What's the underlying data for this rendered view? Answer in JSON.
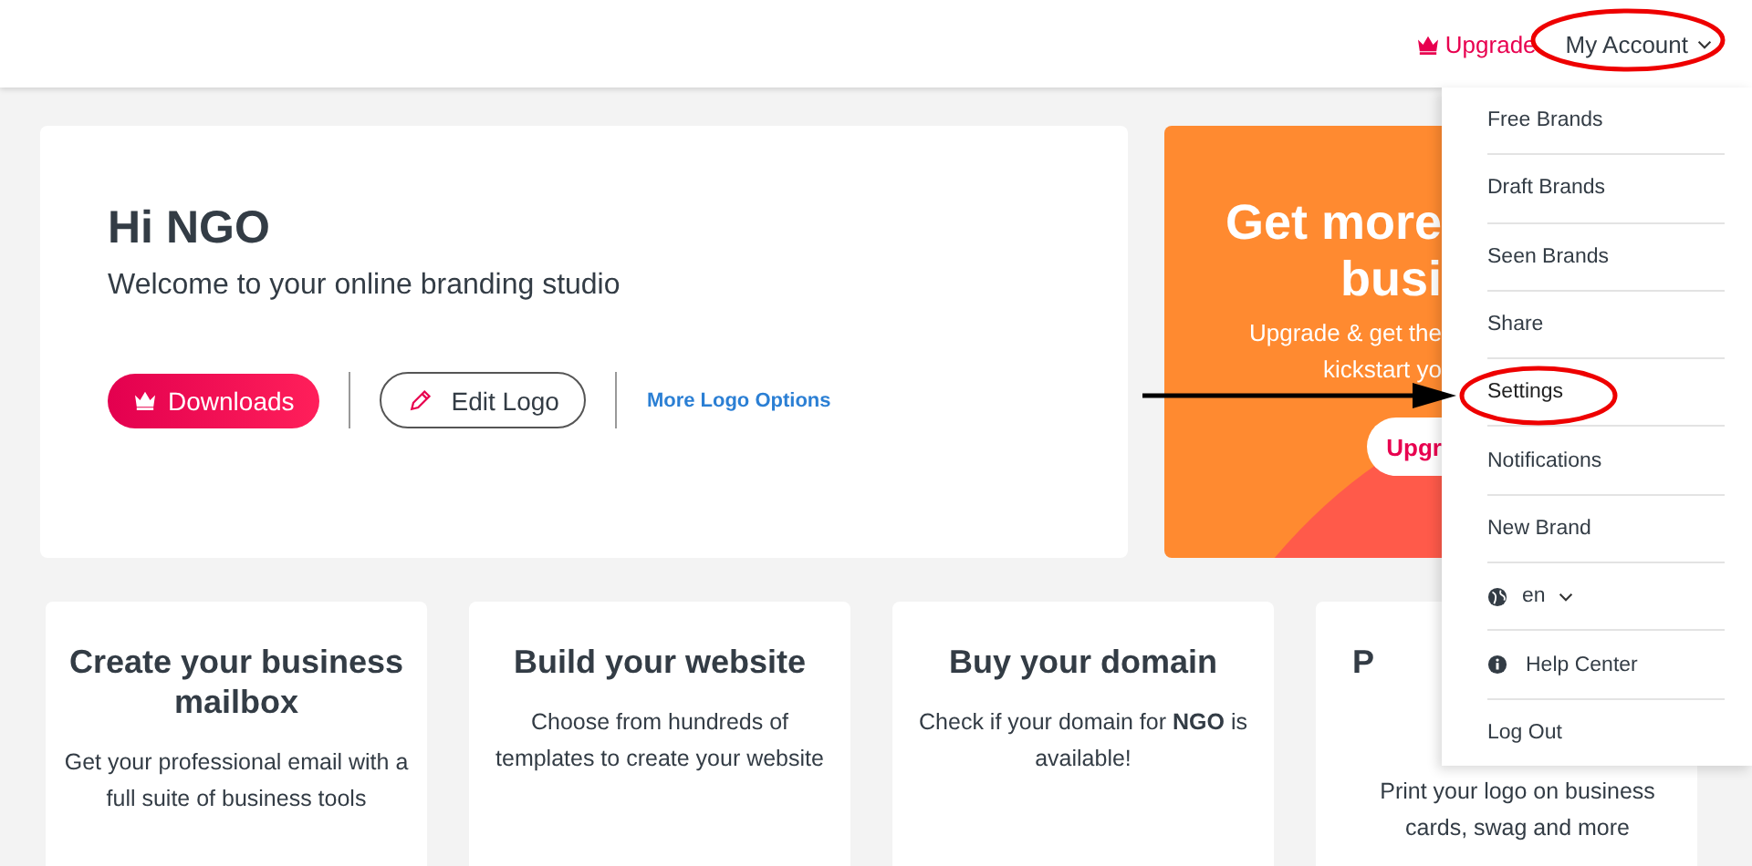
{
  "header": {
    "upgrade": "Upgrade",
    "account": "My Account"
  },
  "hero": {
    "greeting": "Hi NGO",
    "subtitle": "Welcome to your online branding studio",
    "downloads": "Downloads",
    "edit_logo": "Edit Logo",
    "more_options": "More Logo Options"
  },
  "promo": {
    "title_lines": [
      "Get more",
      "busi"
    ],
    "text_lines": [
      "Upgrade & get the",
      "kickstart yo"
    ],
    "button": "Upgr"
  },
  "cards": [
    {
      "title": "Create your business mailbox",
      "text": "Get your professional email with a full suite of business tools"
    },
    {
      "title": "Build your website",
      "text": "Choose from hundreds of templates to create your website"
    },
    {
      "title": "Buy your domain",
      "text": "Check if your domain for **NGO** is available!"
    },
    {
      "title": "P",
      "text": "Print your logo on business cards, swag and more"
    }
  ],
  "menu": [
    {
      "kind": "link",
      "label": "Free Brands",
      "highlighted": false
    },
    {
      "kind": "link",
      "label": "Draft Brands",
      "highlighted": false
    },
    {
      "kind": "link",
      "label": "Seen Brands",
      "highlighted": false
    },
    {
      "kind": "link",
      "label": "Share",
      "highlighted": false
    },
    {
      "kind": "link",
      "label": "Settings",
      "highlighted": true
    },
    {
      "kind": "link",
      "label": "Notifications",
      "highlighted": false
    },
    {
      "kind": "link",
      "label": "New Brand",
      "highlighted": false
    },
    {
      "kind": "language",
      "label": "en",
      "highlighted": false
    },
    {
      "kind": "help",
      "label": "Help Center",
      "highlighted": false
    },
    {
      "kind": "link",
      "label": "Log Out",
      "highlighted": false
    }
  ]
}
